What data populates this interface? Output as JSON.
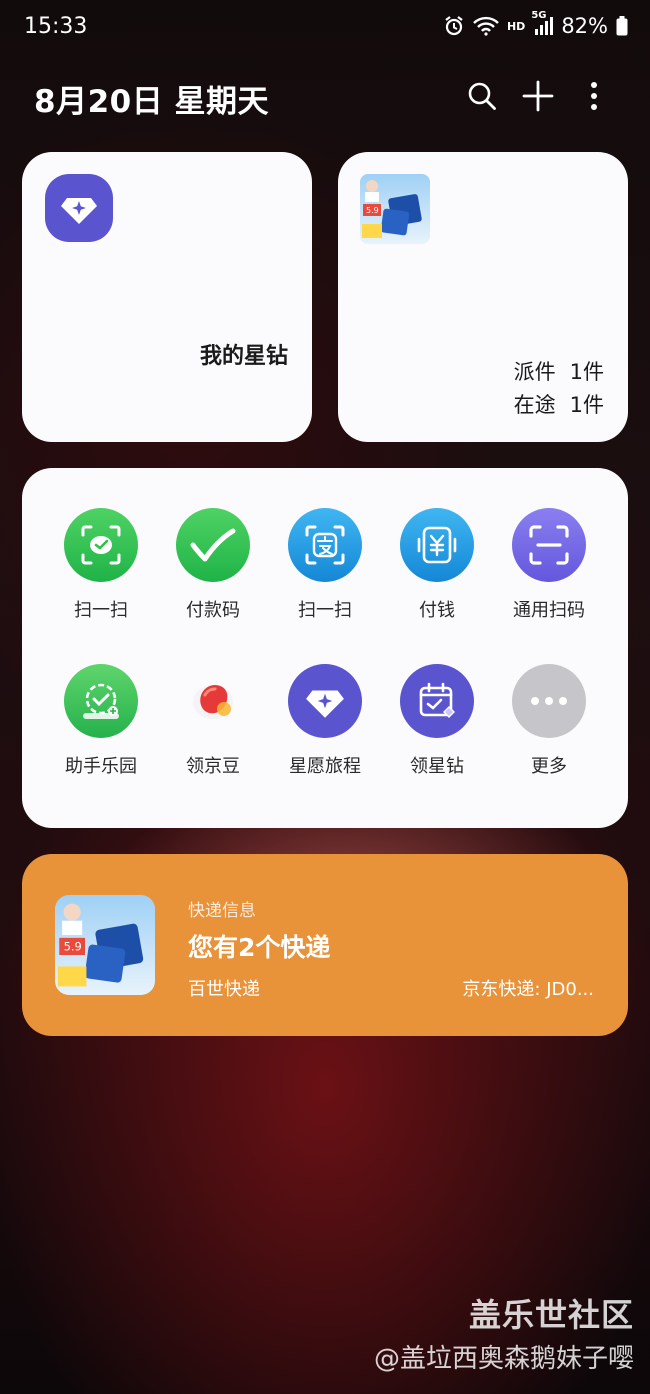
{
  "status_bar": {
    "time": "15:33",
    "network_hd": "HD",
    "network_5g": "5G",
    "battery": "82%"
  },
  "header": {
    "date": "8月20日 星期天",
    "icons": [
      "search-icon",
      "add-icon",
      "more-vert-icon"
    ]
  },
  "diamond_card": {
    "label": "我的星钻",
    "icon": "star-diamond-icon",
    "icon_color": "#5a55cf"
  },
  "parcel_card": {
    "lines": [
      {
        "label": "派件",
        "value": "1件"
      },
      {
        "label": "在途",
        "value": "1件"
      }
    ]
  },
  "shortcuts": {
    "row1": [
      {
        "label": "扫一扫",
        "icon": "wechat-scan-icon",
        "color": "#2fc24a"
      },
      {
        "label": "付款码",
        "icon": "wechat-pay-icon",
        "color": "#2fc24a"
      },
      {
        "label": "扫一扫",
        "icon": "alipay-scan-icon",
        "color": "#1a9ae6"
      },
      {
        "label": "付钱",
        "icon": "alipay-pay-icon",
        "color": "#1a9ae6"
      },
      {
        "label": "通用扫码",
        "icon": "general-scan-icon",
        "color": "#6a5fe0"
      }
    ],
    "row2": [
      {
        "label": "助手乐园",
        "icon": "assistant-park-icon",
        "color": "#3ac35a"
      },
      {
        "label": "领京豆",
        "icon": "jd-bean-icon",
        "color": "#e63a3a"
      },
      {
        "label": "星愿旅程",
        "icon": "star-journey-icon",
        "color": "#5a55cf"
      },
      {
        "label": "领星钻",
        "icon": "collect-diamond-icon",
        "color": "#5a55cf"
      },
      {
        "label": "更多",
        "icon": "more-dots-icon",
        "color": "#c8c8cc"
      }
    ]
  },
  "express_card": {
    "category": "快递信息",
    "title": "您有2个快递",
    "company": "百世快递",
    "tracking": "京东快递: JD0...",
    "background": "#e8923a"
  },
  "watermark": {
    "title": "盖乐世社区",
    "handle": "@盖垃西奥森鹅妹子嘤"
  }
}
